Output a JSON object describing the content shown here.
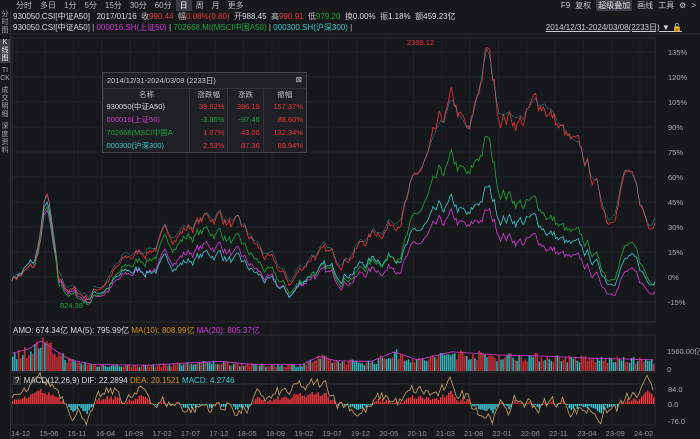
{
  "tabs": [
    "分时",
    "多日",
    "1分",
    "5分",
    "15分",
    "30分",
    "60分",
    "日",
    "周",
    "月",
    "更多"
  ],
  "active_tab": "日",
  "right_toolbar": {
    "f9": "F9",
    "fuquan": "复权",
    "overlay": "超级叠加",
    "draw": "画线",
    "tools": "工具",
    "gear": "gear-icon",
    "more": ">"
  },
  "sidebar": [
    "分时图",
    "K线图",
    "TICK",
    "成交明细",
    "深度资料"
  ],
  "info": {
    "code": "930050.CSI[中证A50]",
    "date": "2017/01/16",
    "close_l": "收",
    "close": "990.44",
    "chg_l": "幅",
    "chg": "0.08%(0.80)",
    "open_l": "开",
    "open": "988.45",
    "high_l": "高",
    "high": "990.91",
    "low_l": "低",
    "low": "979.20",
    "turnover_l": "换",
    "turnover": "0.00%",
    "amp_l": "振",
    "amp": "1.18%",
    "amount_l": "额",
    "amount": "459.23亿"
  },
  "legend": [
    "930050.CSI[中证A50]",
    "000016.SH(上证50)",
    "702668.MI(MSCI中国A50)",
    "000300.SH(沪深300)"
  ],
  "date_range": "2014/12/31-2024/03/08(2233日)",
  "popup": {
    "title": "2014/12/31-2024/03/08 (2233日)",
    "headers": [
      "名称",
      "涨跌幅",
      "涨跌",
      "振幅"
    ],
    "rows": [
      [
        "930050(中证A50)",
        "39.62%",
        "396.19",
        "157.37%"
      ],
      [
        "000016(上证50)",
        "-3.86%",
        "-97.46",
        "88.60%"
      ],
      [
        "702668(MSCI中国A",
        "1.07%",
        "43.06",
        "132.34%"
      ],
      [
        "000300(沪深300)",
        "2.53%",
        "87.36",
        "89.94%"
      ]
    ]
  },
  "colors": {
    "red": "#e8343a",
    "green": "#21a33a",
    "magenta": "#d23cd2",
    "cyan": "#3ec9d0",
    "orange": "#d9941e"
  },
  "chart_data": {
    "type": "line",
    "ylim": [
      -15,
      140
    ],
    "y_ticks": [
      "135%",
      "120%",
      "105%",
      "90%",
      "75%",
      "60%",
      "45%",
      "30%",
      "15%",
      "0%",
      "-15%"
    ],
    "max_label": "2398.12",
    "min_label": "824.38",
    "x_ticks": [
      "14-12",
      "15-06",
      "15-11",
      "16-04",
      "16-09",
      "17-02",
      "17-07",
      "17-12",
      "18-05",
      "18-09",
      "19-02",
      "19-07",
      "19-12",
      "20-05",
      "20-10",
      "21-03",
      "21-08",
      "22-01",
      "22-06",
      "22-11",
      "23-04",
      "23-09",
      "24-02"
    ],
    "months_total": 111,
    "series": [
      {
        "name": "930050.CSI",
        "color": "#e8343a",
        "points": [
          [
            0,
            0
          ],
          [
            4,
            5
          ],
          [
            6,
            50
          ],
          [
            7,
            25
          ],
          [
            8,
            -5
          ],
          [
            13,
            -12
          ],
          [
            20,
            10
          ],
          [
            30,
            30
          ],
          [
            36,
            38
          ],
          [
            40,
            25
          ],
          [
            48,
            -5
          ],
          [
            52,
            15
          ],
          [
            56,
            10
          ],
          [
            60,
            20
          ],
          [
            66,
            35
          ],
          [
            72,
            70
          ],
          [
            76,
            100
          ],
          [
            79,
            80
          ],
          [
            82,
            135
          ],
          [
            84,
            100
          ],
          [
            88,
            95
          ],
          [
            92,
            105
          ],
          [
            96,
            80
          ],
          [
            100,
            60
          ],
          [
            103,
            35
          ],
          [
            106,
            65
          ],
          [
            108,
            45
          ],
          [
            110,
            28
          ],
          [
            111,
            40
          ]
        ]
      },
      {
        "name": "702668.MI",
        "color": "#21a33a",
        "points": [
          [
            0,
            0
          ],
          [
            4,
            5
          ],
          [
            6,
            42
          ],
          [
            7,
            20
          ],
          [
            8,
            -8
          ],
          [
            13,
            -15
          ],
          [
            20,
            5
          ],
          [
            30,
            25
          ],
          [
            36,
            28
          ],
          [
            40,
            15
          ],
          [
            48,
            -10
          ],
          [
            52,
            5
          ],
          [
            56,
            0
          ],
          [
            60,
            5
          ],
          [
            66,
            15
          ],
          [
            72,
            45
          ],
          [
            76,
            65
          ],
          [
            79,
            55
          ],
          [
            82,
            82
          ],
          [
            84,
            55
          ],
          [
            88,
            45
          ],
          [
            92,
            40
          ],
          [
            96,
            25
          ],
          [
            100,
            15
          ],
          [
            103,
            0
          ],
          [
            106,
            20
          ],
          [
            108,
            10
          ],
          [
            110,
            -3
          ],
          [
            111,
            1
          ]
        ]
      },
      {
        "name": "000300.SH",
        "color": "#3ec9d0",
        "points": [
          [
            0,
            0
          ],
          [
            4,
            8
          ],
          [
            6,
            45
          ],
          [
            7,
            22
          ],
          [
            8,
            -5
          ],
          [
            13,
            -12
          ],
          [
            20,
            2
          ],
          [
            30,
            10
          ],
          [
            36,
            15
          ],
          [
            40,
            5
          ],
          [
            48,
            -12
          ],
          [
            52,
            5
          ],
          [
            56,
            2
          ],
          [
            60,
            8
          ],
          [
            66,
            15
          ],
          [
            72,
            30
          ],
          [
            76,
            40
          ],
          [
            79,
            32
          ],
          [
            82,
            52
          ],
          [
            84,
            38
          ],
          [
            88,
            35
          ],
          [
            92,
            30
          ],
          [
            96,
            18
          ],
          [
            100,
            10
          ],
          [
            103,
            -2
          ],
          [
            106,
            12
          ],
          [
            108,
            5
          ],
          [
            110,
            -5
          ],
          [
            111,
            2.5
          ]
        ]
      },
      {
        "name": "000016.SH",
        "color": "#d23cd2",
        "points": [
          [
            0,
            0
          ],
          [
            4,
            5
          ],
          [
            6,
            40
          ],
          [
            7,
            18
          ],
          [
            8,
            -6
          ],
          [
            13,
            -14
          ],
          [
            20,
            0
          ],
          [
            30,
            15
          ],
          [
            36,
            20
          ],
          [
            40,
            8
          ],
          [
            48,
            -12
          ],
          [
            52,
            3
          ],
          [
            56,
            -2
          ],
          [
            60,
            2
          ],
          [
            66,
            8
          ],
          [
            72,
            22
          ],
          [
            76,
            32
          ],
          [
            79,
            25
          ],
          [
            82,
            38
          ],
          [
            84,
            28
          ],
          [
            88,
            22
          ],
          [
            92,
            20
          ],
          [
            96,
            10
          ],
          [
            100,
            2
          ],
          [
            103,
            -8
          ],
          [
            106,
            4
          ],
          [
            108,
            -3
          ],
          [
            110,
            -10
          ],
          [
            111,
            -4
          ]
        ]
      }
    ]
  },
  "volume": {
    "label": "AMO: 674.34亿",
    "ma5": "MA(5): 795.99亿",
    "ma10": "MA(10): 808.99亿",
    "ma20": "MA(20): 805.37亿",
    "axis_top": "1560.00亿",
    "axis_zero": "0",
    "envelope": [
      [
        0,
        0.55
      ],
      [
        3,
        0.7
      ],
      [
        5,
        0.95
      ],
      [
        7,
        0.7
      ],
      [
        10,
        0.35
      ],
      [
        14,
        0.2
      ],
      [
        24,
        0.18
      ],
      [
        30,
        0.25
      ],
      [
        36,
        0.3
      ],
      [
        42,
        0.2
      ],
      [
        50,
        0.2
      ],
      [
        53,
        0.45
      ],
      [
        56,
        0.32
      ],
      [
        62,
        0.3
      ],
      [
        66,
        0.6
      ],
      [
        70,
        0.35
      ],
      [
        76,
        0.6
      ],
      [
        80,
        0.55
      ],
      [
        84,
        0.5
      ],
      [
        90,
        0.48
      ],
      [
        100,
        0.4
      ],
      [
        111,
        0.35
      ]
    ]
  },
  "macd": {
    "help": "?",
    "label": "MACD(12,26,9)",
    "dif": "DIF: 22.2894",
    "dea": "DEA: 20.1521",
    "macd": "MACD: 4.2746",
    "axis": [
      "84.0",
      "0.0",
      "-76.0"
    ]
  }
}
